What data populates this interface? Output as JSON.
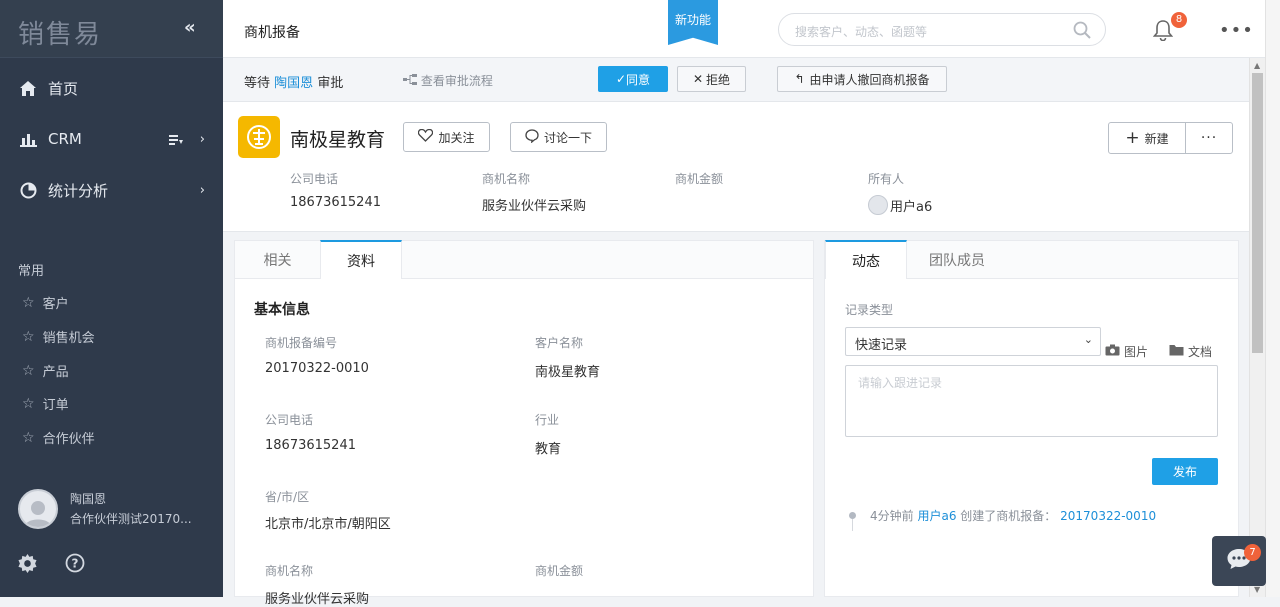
{
  "sidebar": {
    "logo": "销售易",
    "nav": [
      {
        "label": "首页"
      },
      {
        "label": "CRM"
      },
      {
        "label": "统计分析"
      }
    ],
    "group_title": "常用",
    "favorites": [
      "客户",
      "销售机会",
      "产品",
      "订单",
      "合作伙伴"
    ],
    "user": {
      "name": "陶国恩",
      "org": "合作伙伴测试20170..."
    }
  },
  "topbar": {
    "breadcrumb": "商机报备",
    "new_feature": "新功能",
    "search_placeholder": "搜索客户、动态、函题等",
    "notification_count": "8"
  },
  "approval": {
    "prefix": "等待",
    "approver": "陶国恩",
    "suffix": "审批",
    "view_flow": "查看审批流程",
    "approve": "同意",
    "reject": "拒绝",
    "withdraw": "由申请人撤回商机报备"
  },
  "header": {
    "name": "南极星教育",
    "follow": "加关注",
    "discuss": "讨论一下",
    "new": "新建",
    "fields": [
      {
        "label": "公司电话",
        "value": "18673615241"
      },
      {
        "label": "商机名称",
        "value": "服务业伙伴云采购"
      },
      {
        "label": "商机金额",
        "value": ""
      },
      {
        "label": "所有人",
        "value": "用户a6"
      }
    ]
  },
  "left_panel": {
    "tabs": [
      "相关",
      "资料"
    ],
    "active_tab": "资料",
    "section_title": "基本信息",
    "fields": [
      {
        "label": "商机报备编号",
        "value": "20170322-0010"
      },
      {
        "label": "客户名称",
        "value": "南极星教育"
      },
      {
        "label": "公司电话",
        "value": "18673615241"
      },
      {
        "label": "行业",
        "value": "教育"
      },
      {
        "label": "省/市/区",
        "value": "北京市/北京市/朝阳区"
      },
      {
        "label": "商机名称",
        "value": "服务业伙伴云采购"
      },
      {
        "label": "商机金额",
        "value": ""
      }
    ]
  },
  "right_panel": {
    "tabs": [
      "动态",
      "团队成员"
    ],
    "active_tab": "动态",
    "record_type_label": "记录类型",
    "record_type_value": "快速记录",
    "image": "图片",
    "document": "文档",
    "textarea_placeholder": "请输入跟进记录",
    "publish": "发布",
    "activity": {
      "time": "4分钟前",
      "user": "用户a6",
      "action": "创建了商机报备：",
      "ref": "20170322-0010"
    }
  },
  "chat_badge": "7"
}
